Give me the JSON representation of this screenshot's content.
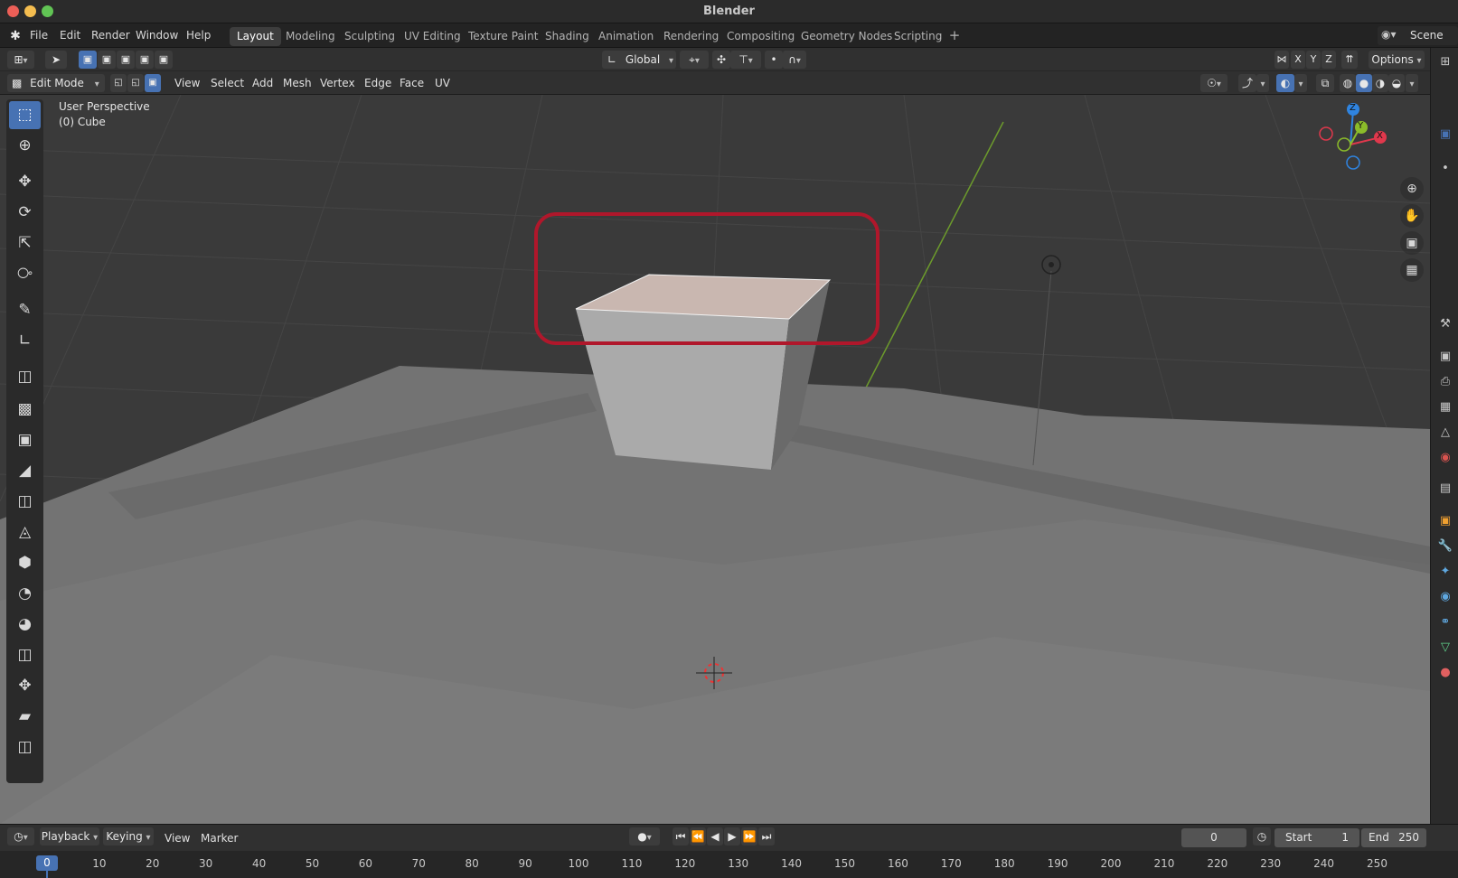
{
  "window": {
    "title": "Blender"
  },
  "menu": {
    "items": [
      "File",
      "Edit",
      "Render",
      "Window",
      "Help"
    ],
    "workspaces": [
      "Layout",
      "Modeling",
      "Sculpting",
      "UV Editing",
      "Texture Paint",
      "Shading",
      "Animation",
      "Rendering",
      "Compositing",
      "Geometry Nodes",
      "Scripting"
    ],
    "active_workspace": "Layout",
    "add_workspace": "+",
    "scene": "Scene"
  },
  "tool_header": {
    "transform_orientation": "Global",
    "axes": [
      "X",
      "Y",
      "Z"
    ],
    "options": "Options"
  },
  "viewport_header": {
    "mode": "Edit Mode",
    "menus": [
      "View",
      "Select",
      "Add",
      "Mesh",
      "Vertex",
      "Edge",
      "Face",
      "UV"
    ]
  },
  "viewport": {
    "perspective": "User Perspective",
    "object": "(0) Cube",
    "gizmo_axes": {
      "x": "X",
      "y": "Y",
      "z": "Z"
    }
  },
  "toolbar": {
    "tools": [
      "select-box",
      "cursor",
      "move",
      "rotate",
      "scale",
      "transform",
      "annotate",
      "measure",
      "add-cube",
      "extrude-region",
      "inset-faces",
      "bevel",
      "loop-cut",
      "knife",
      "poly-build",
      "spin",
      "smooth",
      "edge-slide",
      "shrink-fatten",
      "shear",
      "rip-region"
    ]
  },
  "timeline": {
    "menus": [
      "Playback",
      "Keying",
      "View",
      "Marker"
    ],
    "current_frame": "0",
    "start_label": "Start",
    "start_value": "1",
    "end_label": "End",
    "end_value": "250",
    "ruler_current": "0",
    "ruler_ticks": [
      "10",
      "20",
      "30",
      "40",
      "50",
      "60",
      "70",
      "80",
      "90",
      "100",
      "110",
      "120",
      "130",
      "140",
      "150",
      "160",
      "170",
      "180",
      "190",
      "200",
      "210",
      "220",
      "230",
      "240",
      "250"
    ]
  },
  "colors": {
    "accent": "#4772b3",
    "highlight_box": "#b0172b",
    "selected_face": "#c9b7b0",
    "axis_x": "#e0384c",
    "axis_y": "#8bbc2a",
    "axis_z": "#2f84e0"
  }
}
